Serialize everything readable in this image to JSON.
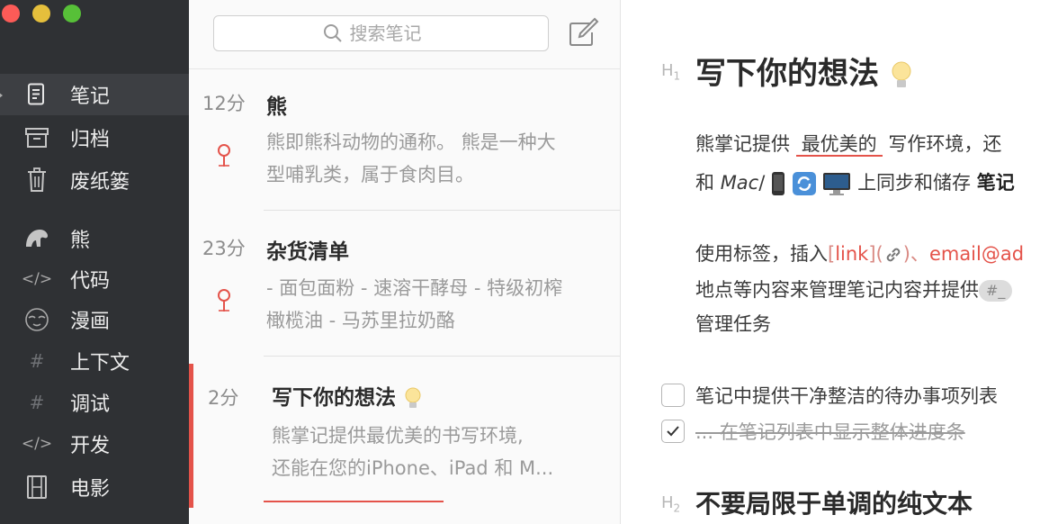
{
  "window": {
    "traffic_colors": [
      "#fc5b57",
      "#e5bf3c",
      "#57c038"
    ]
  },
  "sidebar": {
    "items": [
      {
        "label": "笔记",
        "icon": "note-icon",
        "active": true
      },
      {
        "label": "归档",
        "icon": "archive-icon"
      },
      {
        "label": "废纸篓",
        "icon": "trash-icon"
      },
      {
        "label": "熊",
        "icon": "bear-icon"
      },
      {
        "label": "代码",
        "icon": "code-icon"
      },
      {
        "label": "漫画",
        "icon": "mask-icon"
      },
      {
        "label": "上下文",
        "icon": "hashtag-icon"
      },
      {
        "label": "调试",
        "icon": "hashtag-icon"
      },
      {
        "label": "开发",
        "icon": "code-icon"
      },
      {
        "label": "电影",
        "icon": "film-icon"
      }
    ]
  },
  "search": {
    "placeholder": "搜索笔记"
  },
  "notes": [
    {
      "time": "12分",
      "title": "熊",
      "excerpt": [
        "熊即熊科动物的通称。 熊是一种大",
        "型哺乳类，属于食肉目。"
      ],
      "pinned": true
    },
    {
      "time": "23分",
      "title": "杂货清单",
      "excerpt": [
        "- 面包面粉 - 速溶干酵母 - 特级初榨",
        "橄榄油 - 马苏里拉奶酪"
      ],
      "pinned": true
    },
    {
      "time": "2分",
      "title": "写下你的想法",
      "excerpt": [
        "熊掌记提供最优美的书写环境,",
        "还能在您的iPhone、iPad 和 M..."
      ],
      "selected": true,
      "icon": "lightbulb-icon"
    }
  ],
  "editor": {
    "h1_marker": "H",
    "h1_marker_sub": "1",
    "h1": "写下你的想法",
    "p1_line1_a": "熊掌记提供",
    "p1_line1_highlight": "最优美的",
    "p1_line1_b": "写作环境，还",
    "p1_line2_a": "和 ",
    "p1_line2_italic": "Mac",
    "p1_line2_b": "/ ",
    "p1_line2_c": "上同步和储存",
    "p1_line2_bold": "笔记",
    "p2_line1_a": "使用标签，插入",
    "p2_bracket_open": "[",
    "p2_link": "link",
    "p2_bracket_mid": "](",
    "p2_bracket_close": ")、",
    "p2_email": "email@ad",
    "p2_line2": "地点等内容来管理笔记内容并提供",
    "p2_tag": "#_",
    "p2_line3": "管理任务",
    "todos": [
      {
        "text": "笔记中提供干净整洁的待办事项列表",
        "done": false
      },
      {
        "text": "... 在笔记列表中显示整体进度条",
        "done": true
      }
    ],
    "h2_marker": "H",
    "h2_marker_sub": "2",
    "h2": "不要局限于单调的纯文本"
  }
}
